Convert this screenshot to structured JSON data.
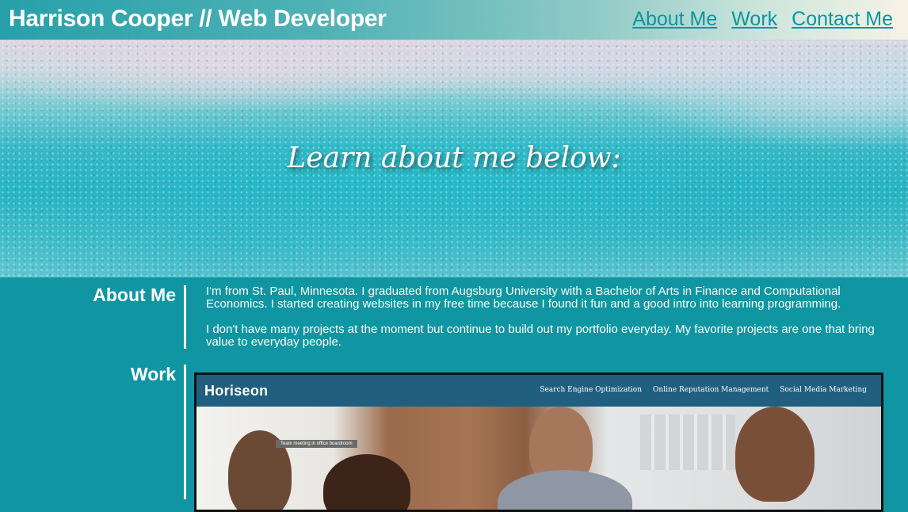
{
  "header": {
    "title": "Harrison Cooper // Web Developer",
    "nav": [
      {
        "label": "About Me"
      },
      {
        "label": "Work"
      },
      {
        "label": "Contact Me"
      }
    ]
  },
  "hero": {
    "heading": "Learn about me below:"
  },
  "about": {
    "label": "About Me",
    "paragraphs": [
      "I'm from St. Paul, Minnesota. I graduated from Augsburg University with a Bachelor of Arts in Finance and Computational Economics. I started creating websites in my free time because I found it fun and a good intro into learning programming.",
      "I don't have many projects at the moment but continue to build out my portfolio everyday. My favorite projects are one that bring value to everyday people."
    ]
  },
  "work": {
    "label": "Work",
    "project": {
      "logo": "Horiseon",
      "nav": [
        "Search Engine Optimization",
        "Online Reputation Management",
        "Social Media Marketing"
      ],
      "caption": "Team meeting in office boardroom"
    }
  },
  "colors": {
    "page_background": "#0f96a2",
    "nav_link": "#0c95a1",
    "text": "#ffffff",
    "preview_header": "#215f80"
  }
}
